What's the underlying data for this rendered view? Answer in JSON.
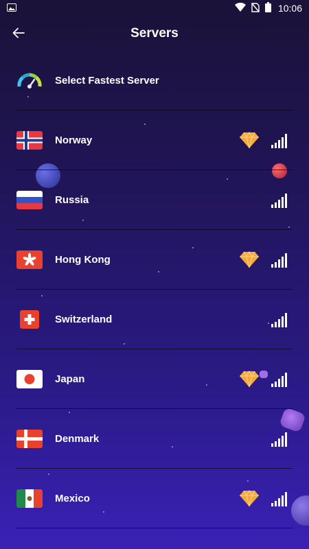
{
  "status_bar": {
    "time": "10:06",
    "icons": [
      "image-icon",
      "wifi-icon",
      "no-sim-icon",
      "battery-icon"
    ]
  },
  "header": {
    "title": "Servers",
    "back_icon": "arrow-back-icon"
  },
  "fastest": {
    "label": "Select Fastest Server",
    "icon": "speedometer-icon"
  },
  "servers": [
    {
      "name": "Norway",
      "flag": "norway-flag",
      "premium": true
    },
    {
      "name": "Russia",
      "flag": "russia-flag",
      "premium": false
    },
    {
      "name": "Hong Kong",
      "flag": "hong-kong-flag",
      "premium": true
    },
    {
      "name": "Switzerland",
      "flag": "switzerland-flag",
      "premium": false
    },
    {
      "name": "Japan",
      "flag": "japan-flag",
      "premium": true
    },
    {
      "name": "Denmark",
      "flag": "denmark-flag",
      "premium": false
    },
    {
      "name": "Mexico",
      "flag": "mexico-flag",
      "premium": true
    }
  ],
  "colors": {
    "background_top": "#1a1238",
    "background_bottom": "#3a21b5",
    "gem": "#f6a93b",
    "divider": "#0a061e"
  }
}
